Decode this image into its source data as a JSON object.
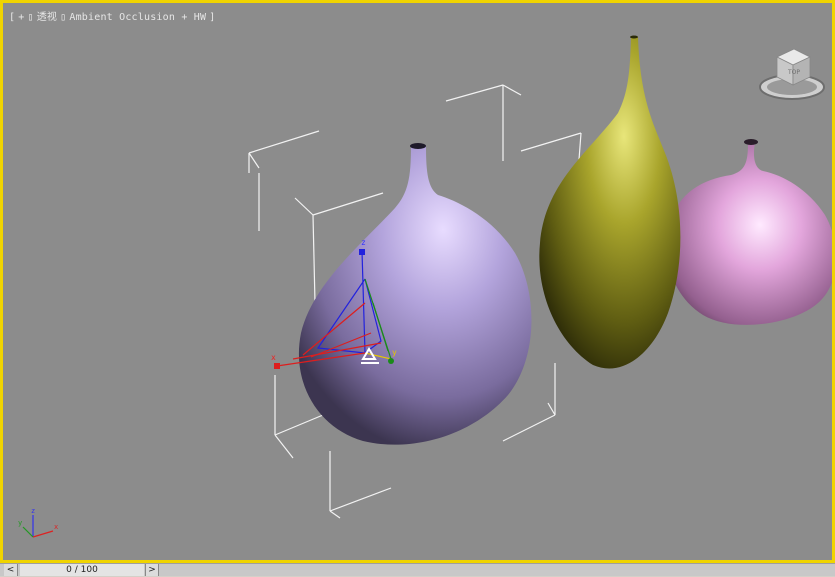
{
  "viewport": {
    "label": {
      "bracket_open": "[",
      "plus": "+",
      "sep1": "▯",
      "view_name": "透视",
      "sep2": "▯",
      "shading": "Ambient Occlusion + HW",
      "bracket_close": "]"
    },
    "colors": {
      "active_border": "#f0d400",
      "background": "#8c8c8c"
    }
  },
  "gizmo": {
    "axis_x": "x",
    "axis_y": "y",
    "axis_z": "z"
  },
  "axis_tripod": {
    "x": "x",
    "y": "y",
    "z": "z"
  },
  "viewcube": {
    "face_label": "TOP"
  },
  "timeline": {
    "prev_label": "<",
    "position": "0 / 100",
    "next_label": ">"
  },
  "objects": [
    {
      "name": "purple-vase",
      "color": "#a89bd6"
    },
    {
      "name": "olive-vase",
      "color": "#a8a42a"
    },
    {
      "name": "pink-vase",
      "color": "#e6a8dc"
    }
  ]
}
